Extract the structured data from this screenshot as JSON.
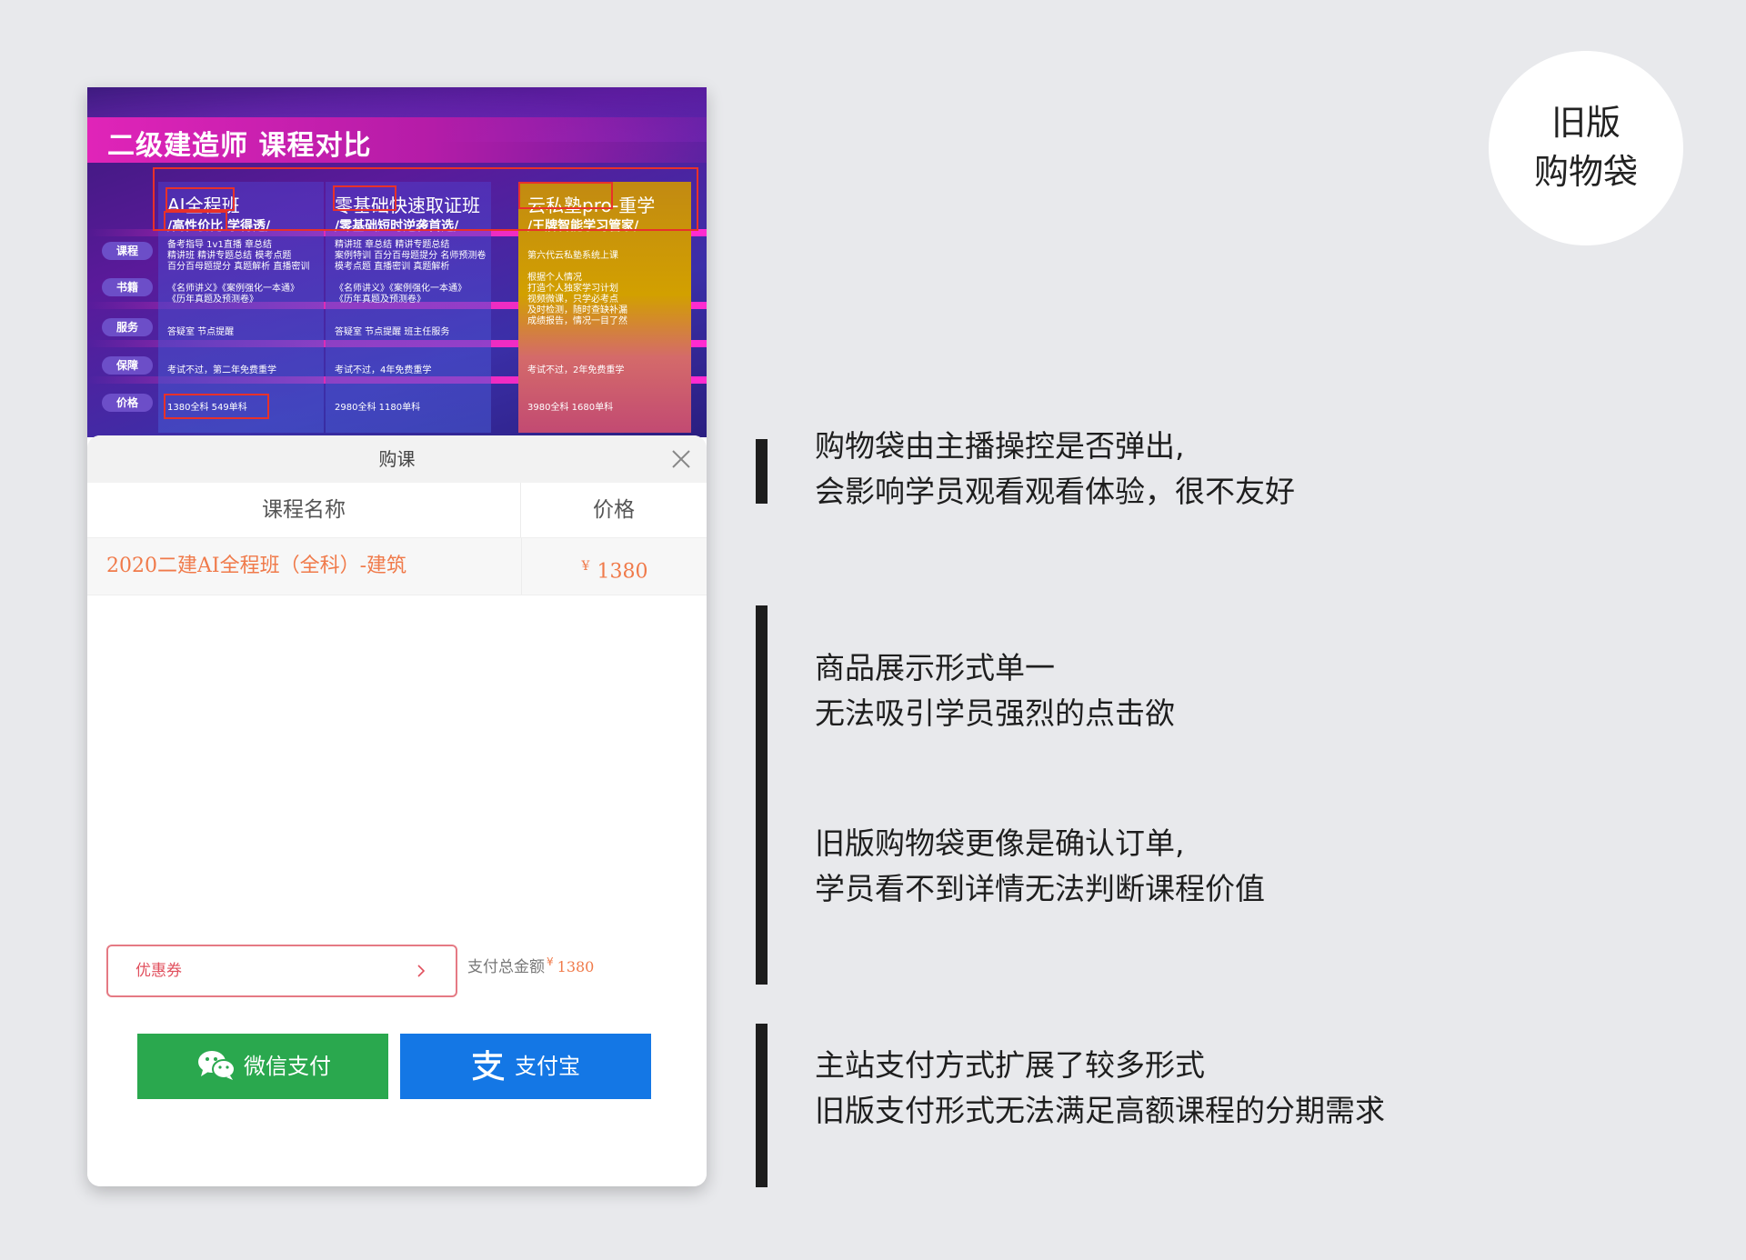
{
  "banner": {
    "title": "二级建造师 课程对比",
    "row_labels": [
      "课程",
      "书籍",
      "服务",
      "保障",
      "价格"
    ],
    "columns": [
      {
        "name_prefix": "AI全程班",
        "subtitle": "/高性价比 学得透/",
        "course": [
          "备考指导 1v1直播 章总结",
          "精讲班 精讲专题总结 模考点题",
          "百分百母题提分 真题解析 直播密训"
        ],
        "books": [
          "《名师讲义》《案例强化一本通》",
          "《历年真题及预测卷》"
        ],
        "service": "答疑室 节点提醒",
        "guarantee": "考试不过，第二年免费重学",
        "price": "1380全科 549单科"
      },
      {
        "name_prefix": "零基础快速取证班",
        "subtitle": "/零基础短时逆袭首选/",
        "course": [
          "精讲班 章总结 精讲专题总结",
          "案例特训 百分百母题提分 名师预测卷",
          "模考点题 直播密训 真题解析"
        ],
        "books": [
          "《名师讲义》《案例强化一本通》",
          "《历年真题及预测卷》"
        ],
        "service": "答疑室 节点提醒 班主任服务",
        "guarantee": "考试不过，4年免费重学",
        "price": "2980全科 1180单科"
      },
      {
        "name_prefix": "云私塾pro-重学",
        "subtitle": "/王牌智能学习管家/",
        "course": [
          "第六代云私塾系统上课"
        ],
        "books": [
          "根据个人情况",
          "打造个人独家学习计划",
          "视频微课，只学必考点",
          "及时检测，随时查缺补漏",
          "成绩报告，情况一目了然"
        ],
        "service": "",
        "guarantee": "考试不过，2年免费重学",
        "price": "3980全科 1680单科"
      }
    ]
  },
  "sheet": {
    "title": "购课",
    "col_course": "课程名称",
    "col_price": "价格",
    "rows": [
      {
        "course": "2020二建AI全程班（全科）-建筑",
        "currency": "¥",
        "price": "1380"
      }
    ],
    "coupon_label": "优惠券",
    "total_label": "支付总金额",
    "total_currency": "¥",
    "total_amount": "1380",
    "wechat_label": "微信支付",
    "alipay_label": "支付宝"
  },
  "badge": {
    "line1": "旧版",
    "line2": "购物袋"
  },
  "notes": [
    [
      "购物袋由主播操控是否弹出,",
      "会影响学员观看观看体验，很不友好"
    ],
    [
      "商品展示形式单一",
      "无法吸引学员强烈的点击欲"
    ],
    [
      "旧版购物袋更像是确认订单,",
      "学员看不到详情无法判断课程价值"
    ],
    [
      "主站支付方式扩展了较多形式",
      "旧版支付形式无法满足高额课程的分期需求"
    ]
  ],
  "colors": {
    "accent_orange": "#f07a4a",
    "wechat_green": "#2aa84e",
    "alipay_blue": "#1477e5"
  }
}
